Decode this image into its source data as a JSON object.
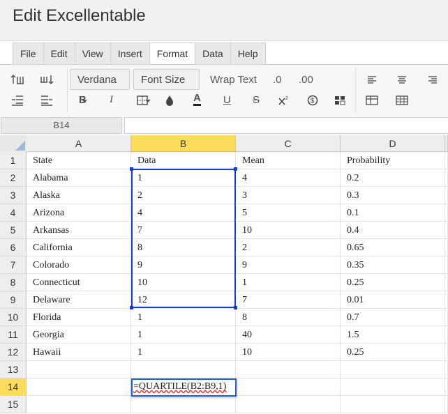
{
  "app_title": "Edit Excellentable",
  "menu": [
    "File",
    "Edit",
    "View",
    "Insert",
    "Format",
    "Data",
    "Help"
  ],
  "toolbar": {
    "font_family": "Verdana",
    "font_size": "Font Size",
    "wrap_text": "Wrap Text",
    "dec_decrease": ".0",
    "dec_increase": ".00",
    "bold": "B",
    "italic": "I",
    "text_color": "A",
    "underline": "U",
    "strikethrough": "S"
  },
  "name_box": "B14",
  "columns": [
    "A",
    "B",
    "C",
    "D"
  ],
  "rows": [
    {
      "num": "1",
      "cells": [
        "State",
        "Data",
        "Mean",
        "Probability"
      ]
    },
    {
      "num": "2",
      "cells": [
        "Alabama",
        "1",
        "4",
        "0.2"
      ]
    },
    {
      "num": "3",
      "cells": [
        "Alaska",
        "2",
        "3",
        "0.3"
      ]
    },
    {
      "num": "4",
      "cells": [
        "Arizona",
        "4",
        "5",
        "0.1"
      ]
    },
    {
      "num": "5",
      "cells": [
        "Arkansas",
        "7",
        "10",
        "0.4"
      ]
    },
    {
      "num": "6",
      "cells": [
        "California",
        "8",
        "2",
        "0.65"
      ]
    },
    {
      "num": "7",
      "cells": [
        "Colorado",
        "9",
        "9",
        "0.35"
      ]
    },
    {
      "num": "8",
      "cells": [
        "Connecticut",
        "10",
        "1",
        "0.25"
      ]
    },
    {
      "num": "9",
      "cells": [
        "Delaware",
        "12",
        "7",
        "0.01"
      ]
    },
    {
      "num": "10",
      "cells": [
        "Florida",
        "1",
        "8",
        "0.7"
      ]
    },
    {
      "num": "11",
      "cells": [
        "Georgia",
        "1",
        "40",
        "1.5"
      ]
    },
    {
      "num": "12",
      "cells": [
        "Hawaii",
        "1",
        "10",
        "0.25"
      ]
    },
    {
      "num": "13",
      "cells": [
        "",
        "",
        "",
        ""
      ]
    },
    {
      "num": "14",
      "cells": [
        "",
        "",
        "",
        ""
      ]
    },
    {
      "num": "15",
      "cells": [
        "",
        "",
        "",
        ""
      ]
    }
  ],
  "editor_value": "=QUARTILE(B2:B9,1)",
  "colors": {
    "selected_header": "#fddc5c",
    "selection_border": "#1a3ccc"
  }
}
